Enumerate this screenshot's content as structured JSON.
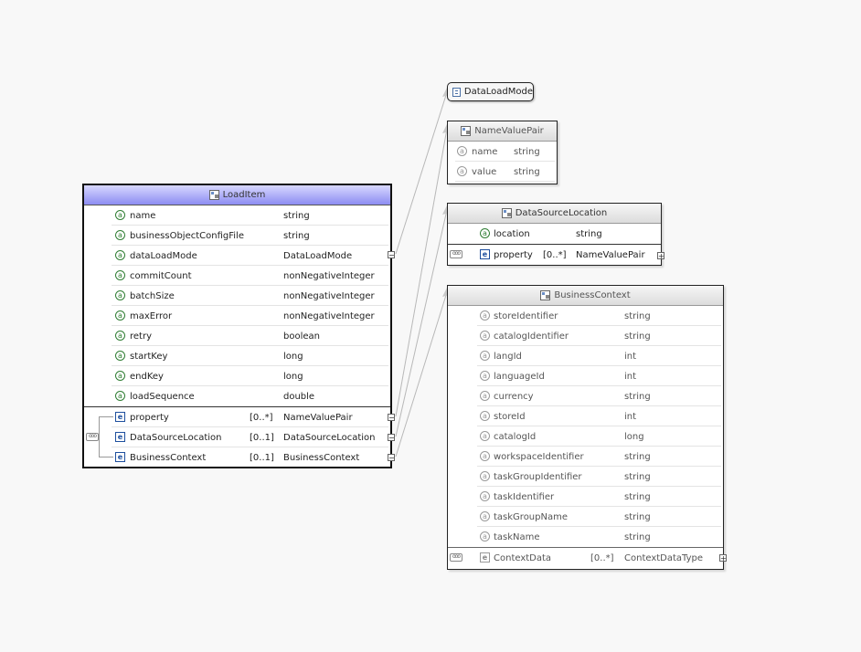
{
  "load_item": {
    "title": "LoadItem",
    "attributes": [
      {
        "name": "name",
        "type": "string"
      },
      {
        "name": "businessObjectConfigFile",
        "type": "string"
      },
      {
        "name": "dataLoadMode",
        "type": "DataLoadMode"
      },
      {
        "name": "commitCount",
        "type": "nonNegativeInteger"
      },
      {
        "name": "batchSize",
        "type": "nonNegativeInteger"
      },
      {
        "name": "maxError",
        "type": "nonNegativeInteger"
      },
      {
        "name": "retry",
        "type": "boolean"
      },
      {
        "name": "startKey",
        "type": "long"
      },
      {
        "name": "endKey",
        "type": "long"
      },
      {
        "name": "loadSequence",
        "type": "double"
      }
    ],
    "elements": [
      {
        "name": "property",
        "card": "[0..*]",
        "type": "NameValuePair"
      },
      {
        "name": "DataSourceLocation",
        "card": "[0..1]",
        "type": "DataSourceLocation"
      },
      {
        "name": "BusinessContext",
        "card": "[0..1]",
        "type": "BusinessContext"
      }
    ]
  },
  "data_load_mode": {
    "title": "DataLoadMode"
  },
  "name_value_pair": {
    "title": "NameValuePair",
    "attributes": [
      {
        "name": "name",
        "type": "string"
      },
      {
        "name": "value",
        "type": "string"
      }
    ]
  },
  "data_source_location": {
    "title": "DataSourceLocation",
    "attributes": [
      {
        "name": "location",
        "type": "string"
      }
    ],
    "elements": [
      {
        "name": "property",
        "card": "[0..*]",
        "type": "NameValuePair"
      }
    ]
  },
  "business_context": {
    "title": "BusinessContext",
    "attributes": [
      {
        "name": "storeIdentifier",
        "type": "string"
      },
      {
        "name": "catalogIdentifier",
        "type": "string"
      },
      {
        "name": "langId",
        "type": "int"
      },
      {
        "name": "languageId",
        "type": "int"
      },
      {
        "name": "currency",
        "type": "string"
      },
      {
        "name": "storeId",
        "type": "int"
      },
      {
        "name": "catalogId",
        "type": "long"
      },
      {
        "name": "workspaceIdentifier",
        "type": "string"
      },
      {
        "name": "taskGroupIdentifier",
        "type": "string"
      },
      {
        "name": "taskIdentifier",
        "type": "string"
      },
      {
        "name": "taskGroupName",
        "type": "string"
      },
      {
        "name": "taskName",
        "type": "string"
      }
    ],
    "elements": [
      {
        "name": "ContextData",
        "card": "[0..*]",
        "type": "ContextDataType"
      }
    ]
  },
  "icons": {
    "attribute": "a",
    "element": "e",
    "collapse": "−",
    "expand": "+",
    "sequence": "ooo"
  }
}
